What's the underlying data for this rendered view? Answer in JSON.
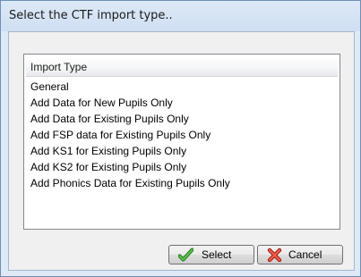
{
  "dialog": {
    "title": "Select the CTF import type.."
  },
  "list": {
    "header": "Import Type",
    "items": [
      "General",
      "Add Data for New Pupils Only",
      "Add Data for Existing Pupils Only",
      "Add FSP data for Existing Pupils Only",
      "Add KS1 for Existing Pupils Only",
      "Add KS2 for Existing Pupils Only",
      "Add Phonics Data for Existing Pupils Only"
    ]
  },
  "buttons": {
    "select_label": "Select",
    "cancel_label": "Cancel",
    "select_icon": "check-icon",
    "cancel_icon": "cross-icon"
  },
  "colors": {
    "title_bar": "#cfdff2",
    "window_border": "#6f8fb4",
    "check_green": "#3b9b2e",
    "cross_red": "#d9372c"
  }
}
